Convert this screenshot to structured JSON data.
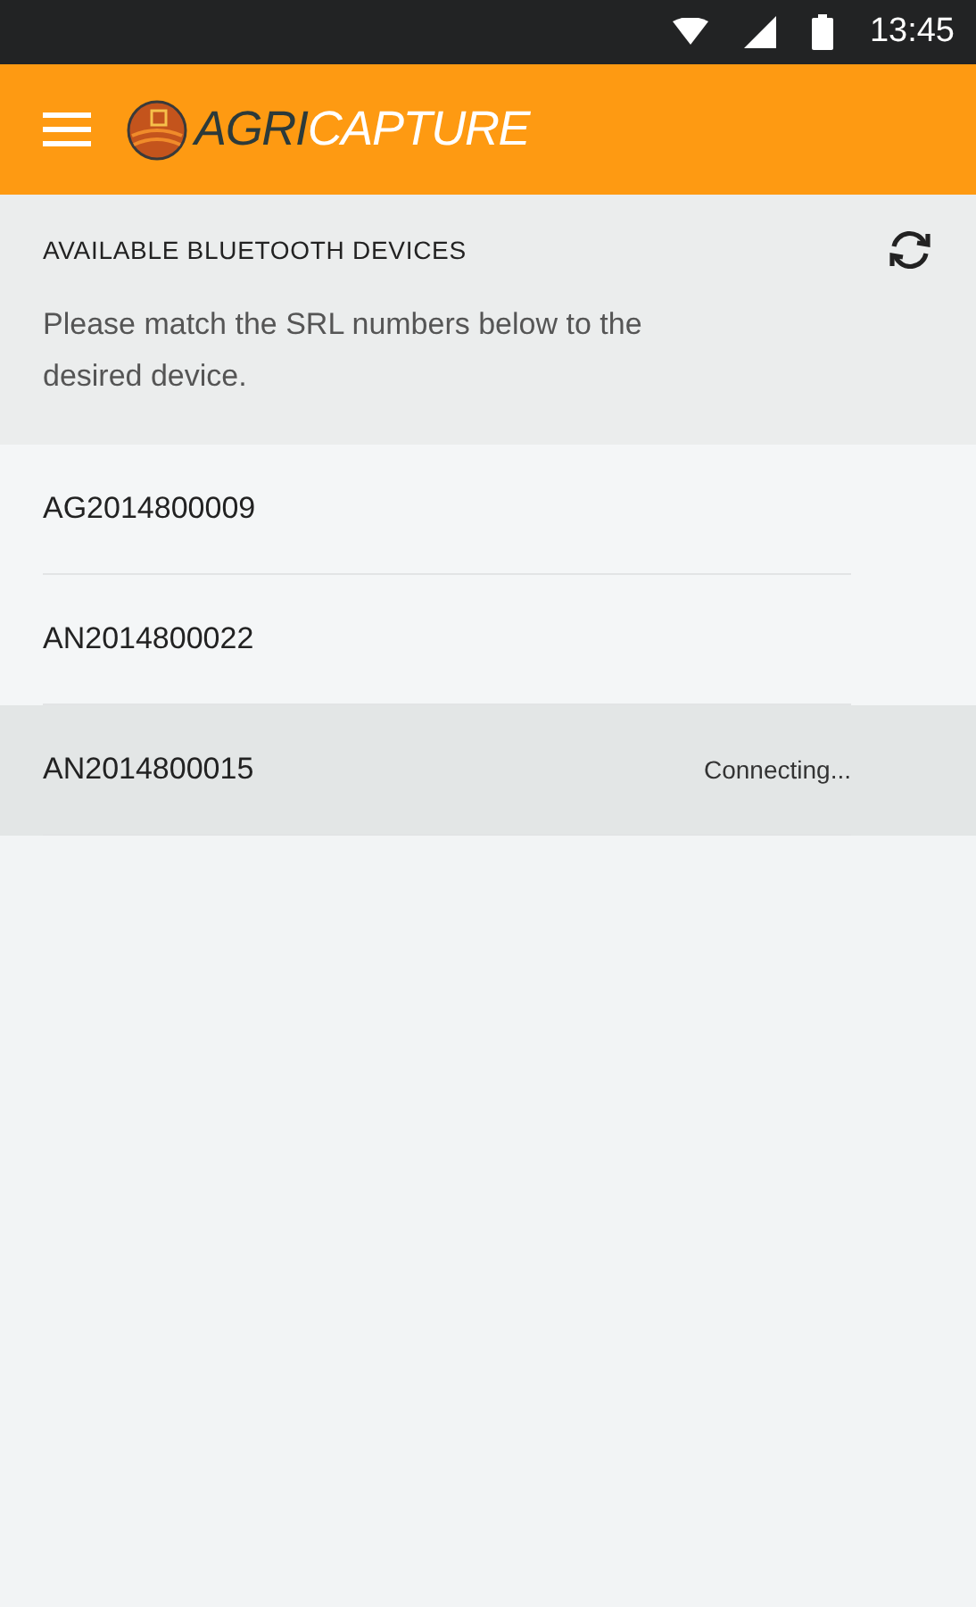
{
  "status_bar": {
    "time": "13:45"
  },
  "app_bar": {
    "logo": {
      "first": "AGRI",
      "second": "CAPTURE"
    }
  },
  "header": {
    "title": "AVAILABLE BLUETOOTH DEVICES",
    "description": "Please match the SRL numbers below to the desired device."
  },
  "devices": [
    {
      "serial": "AG2014800009",
      "selected": false
    },
    {
      "serial": "AN2014800022",
      "selected": false
    },
    {
      "serial": "AN2014800015",
      "selected": true,
      "status": "Connecting..."
    }
  ]
}
